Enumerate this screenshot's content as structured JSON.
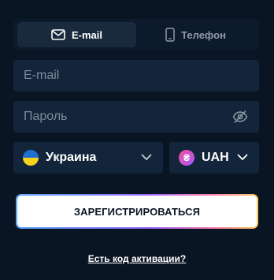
{
  "tabs": {
    "email_label": "E-mail",
    "phone_label": "Телефон"
  },
  "form": {
    "email_placeholder": "E-mail",
    "password_placeholder": "Пароль"
  },
  "country": {
    "label": "Украина",
    "flag_colors": [
      "#1f6ed4",
      "#f7d21a"
    ]
  },
  "currency": {
    "label": "UAH",
    "symbol": "₴"
  },
  "register_label": "ЗАРЕГИСТРИРОВАТЬСЯ",
  "activation_link": "Есть код активации?",
  "colors": {
    "background": "#0a1524",
    "field": "#13253a",
    "button": "#ffffff"
  }
}
